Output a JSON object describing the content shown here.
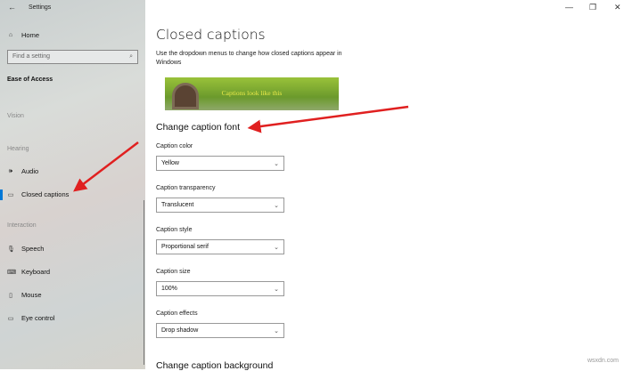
{
  "window": {
    "title": "Settings",
    "controls": {
      "minimize": "—",
      "restore": "❐",
      "close": "✕"
    }
  },
  "sidebar": {
    "back": "←",
    "home": "Home",
    "search_placeholder": "Find a setting",
    "category": "Ease of Access",
    "sections": {
      "vision": "Vision",
      "hearing": "Hearing",
      "interaction": "Interaction"
    },
    "items": [
      {
        "label": "Audio",
        "icon": "🕪"
      },
      {
        "label": "Closed captions",
        "icon": "▭"
      },
      {
        "label": "Speech",
        "icon": "🎙"
      },
      {
        "label": "Keyboard",
        "icon": "⌨"
      },
      {
        "label": "Mouse",
        "icon": "▯"
      },
      {
        "label": "Eye control",
        "icon": "▭"
      }
    ]
  },
  "main": {
    "title": "Closed captions",
    "description": "Use the dropdown menus to change how closed captions appear in Windows",
    "preview_text": "Captions look like this",
    "font_section": "Change caption font",
    "settings": [
      {
        "label": "Caption color",
        "value": "Yellow"
      },
      {
        "label": "Caption transparency",
        "value": "Translucent"
      },
      {
        "label": "Caption style",
        "value": "Proportional serif"
      },
      {
        "label": "Caption size",
        "value": "100%"
      },
      {
        "label": "Caption effects",
        "value": "Drop shadow"
      }
    ],
    "background_section": "Change caption background"
  },
  "watermark": "wsxdn.com",
  "colors": {
    "accent": "#0078d7",
    "arrow": "#e02020"
  }
}
